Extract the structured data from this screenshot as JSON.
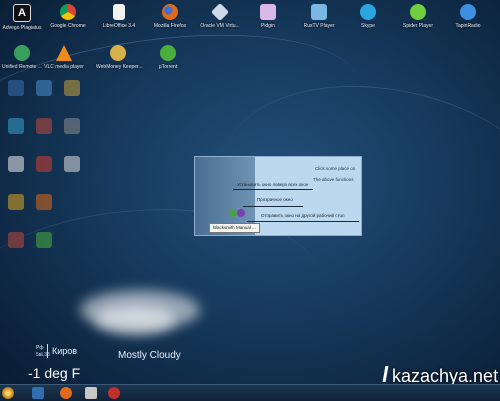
{
  "desktop": {
    "top_row": [
      {
        "label": "Advego Plagiatus",
        "icon": "advego-icon",
        "color": "#ffffff",
        "glyph": "A"
      },
      {
        "label": "Google Chrome",
        "icon": "chrome-icon",
        "color": "#e8c53a"
      },
      {
        "label": "LibreOffice 3.4",
        "icon": "libreoffice-icon",
        "color": "#f2f2f2"
      },
      {
        "label": "Mozilla Firefox",
        "icon": "firefox-icon",
        "color": "#e06a1b"
      },
      {
        "label": "Oracle VM Virtu...",
        "icon": "virtualbox-icon",
        "color": "#cfd8e6"
      },
      {
        "label": "Pidgin",
        "icon": "pidgin-icon",
        "color": "#d9b8e8"
      },
      {
        "label": "RusTV Player",
        "icon": "rustv-icon",
        "color": "#7ab7e6"
      },
      {
        "label": "Skype",
        "icon": "skype-icon",
        "color": "#2aa6e3"
      },
      {
        "label": "Spider Player",
        "icon": "spider-player-icon",
        "color": "#6fcf3f"
      },
      {
        "label": "TapinRadio",
        "icon": "tapinradio-icon",
        "color": "#3d8fe0"
      }
    ],
    "second_row": [
      {
        "label": "Unified Remote ...",
        "icon": "unified-remote-icon",
        "color": "#3a9e5c"
      },
      {
        "label": "VLC media player",
        "icon": "vlc-icon",
        "color": "#f08a1c"
      },
      {
        "label": "WebMoney Keeper...",
        "icon": "webmoney-icon",
        "color": "#d8b04a"
      },
      {
        "label": "µTorrent",
        "icon": "utorrent-icon",
        "color": "#4cae3c"
      }
    ]
  },
  "popup": {
    "line_top_1": "Click some place on",
    "line_top_2": "The above functions",
    "item_1": "Установить окно поверх всех окон",
    "item_2": "Прозрачное окно",
    "item_3": "Отправить окно на другой рабочий стол",
    "tooltip": "Blacksmith Manual ..."
  },
  "weather": {
    "day": "Рф",
    "date": "5вL38",
    "city": "Киров",
    "condition": "Mostly Cloudy",
    "temperature": "-1 deg F"
  },
  "watermark": {
    "text": "kazachya.net"
  },
  "taskbar": {
    "start_icon": "start-orb-icon"
  }
}
